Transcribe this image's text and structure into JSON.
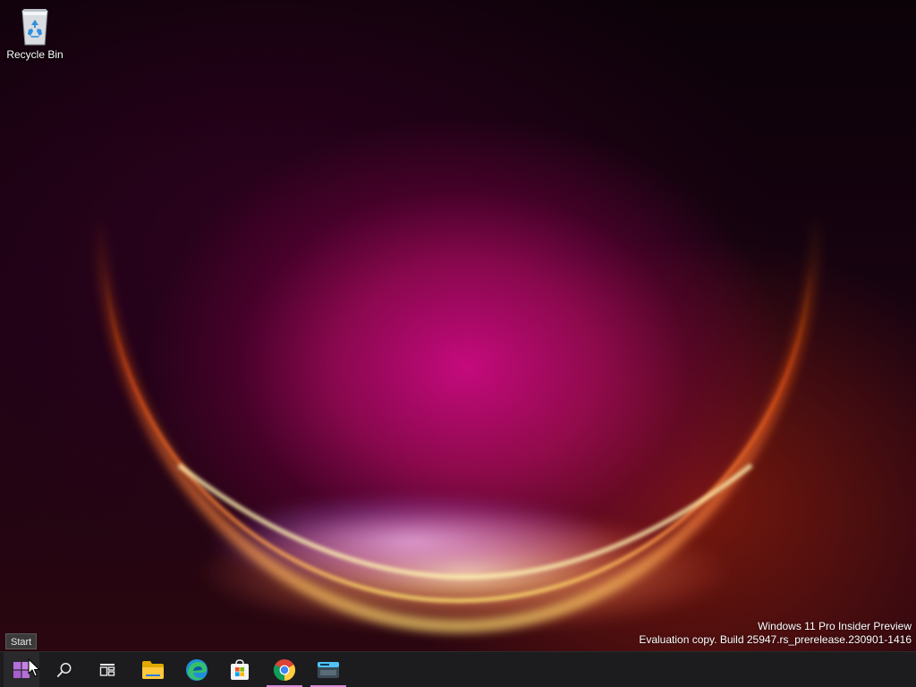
{
  "desktop": {
    "icons": [
      {
        "label": "Recycle Bin",
        "icon": "recycle-bin-icon"
      }
    ],
    "watermark": {
      "line1": "Windows 11 Pro Insider Preview",
      "line2": "Evaluation copy. Build 25947.rs_prerelease.230901-1416"
    }
  },
  "tooltip": {
    "text": "Start"
  },
  "taskbar": {
    "items": [
      {
        "name": "start",
        "icon": "windows-logo-icon",
        "active": false
      },
      {
        "name": "search",
        "icon": "search-icon",
        "active": false
      },
      {
        "name": "task-view",
        "icon": "task-view-icon",
        "active": false
      },
      {
        "name": "file-explorer",
        "icon": "folder-icon",
        "active": false
      },
      {
        "name": "edge",
        "icon": "edge-icon",
        "active": false
      },
      {
        "name": "microsoft-store",
        "icon": "store-icon",
        "active": false
      },
      {
        "name": "chrome",
        "icon": "chrome-icon",
        "active": true
      },
      {
        "name": "terminal",
        "icon": "terminal-icon",
        "active": true
      }
    ]
  },
  "colors": {
    "taskbar_bg": "#1c1c1e",
    "active_indicator": "#d98ad8",
    "windows_logo": "#b56fd8"
  }
}
